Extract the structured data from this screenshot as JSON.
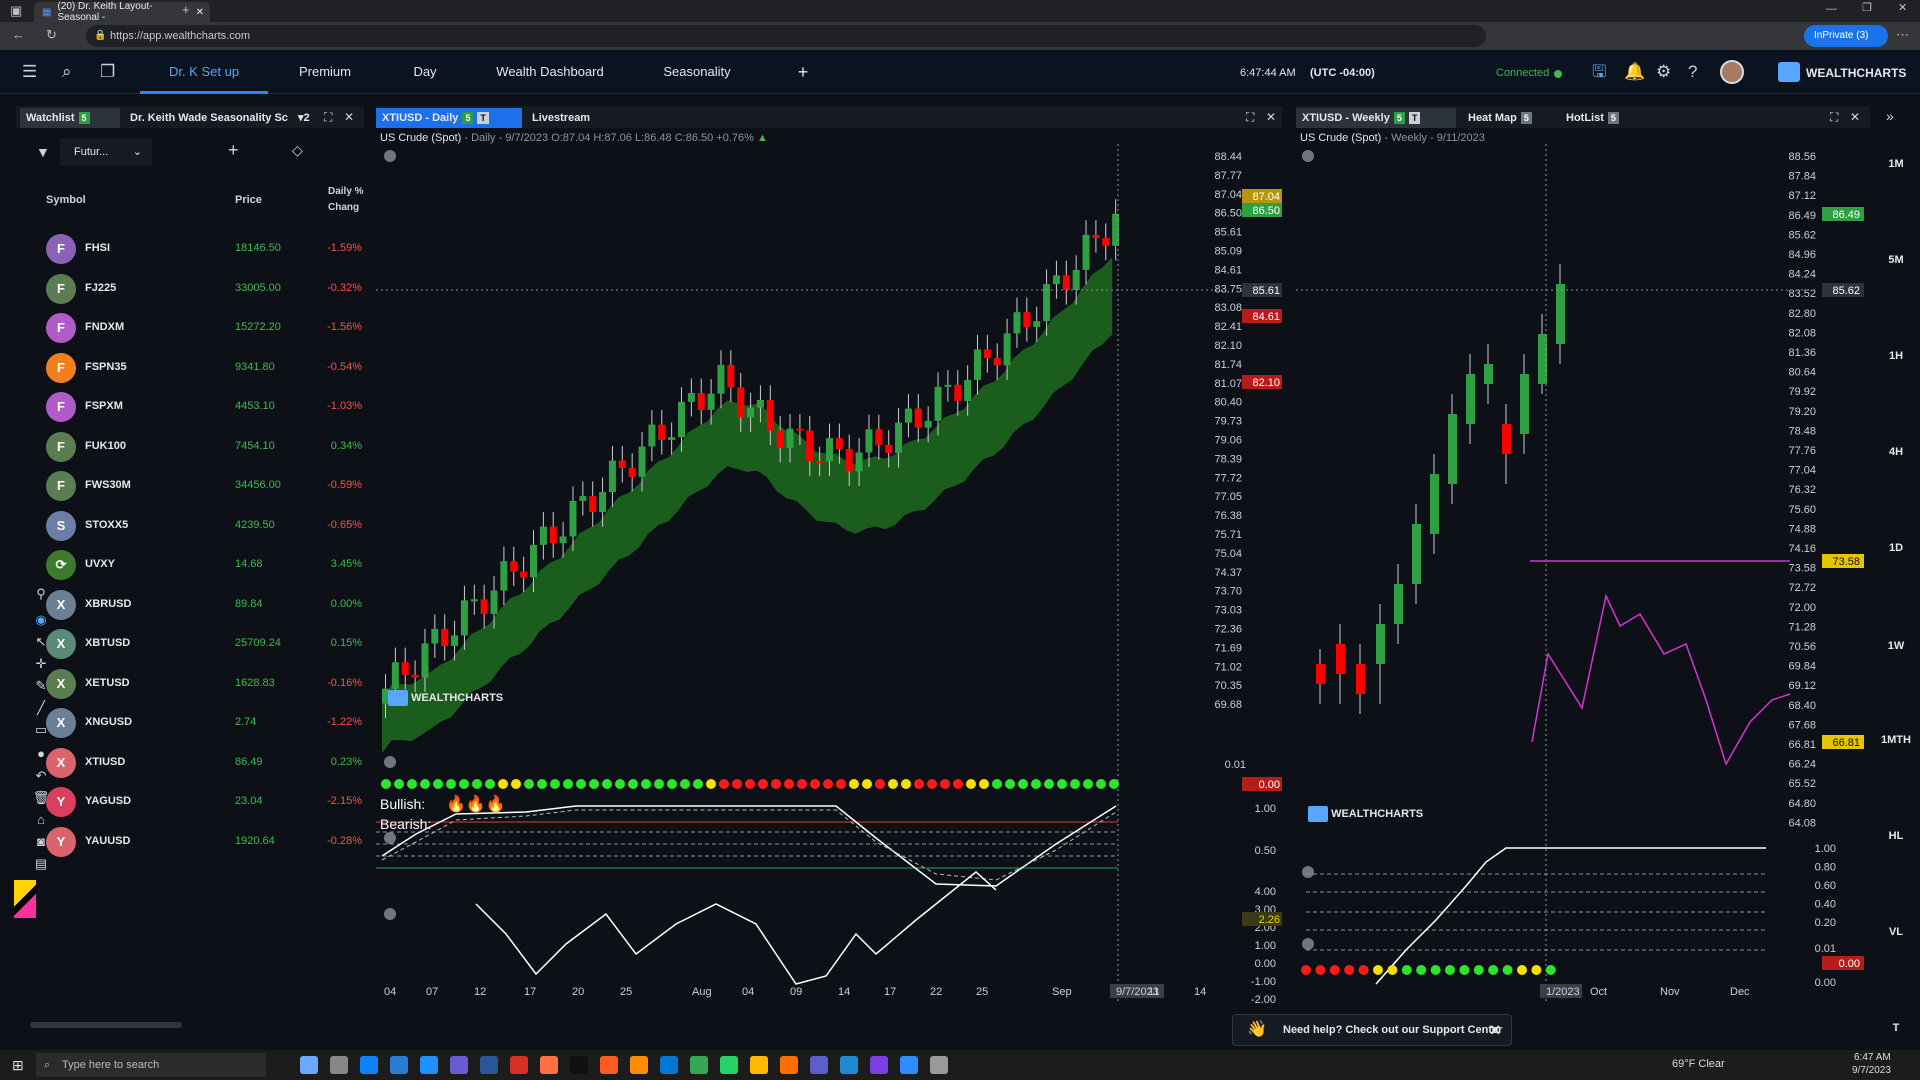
{
  "browser": {
    "tab_title": "(20) Dr. Keith Layout-Seasonal -",
    "url": "https://app.wealthcharts.com",
    "inprivate": "InPrivate (3)"
  },
  "header": {
    "tabs": [
      {
        "label": "Dr. K Set up",
        "active": true
      },
      {
        "label": "Premium"
      },
      {
        "label": "Day"
      },
      {
        "label": "Wealth Dashboard"
      },
      {
        "label": "Seasonality"
      }
    ],
    "add_tab": "+",
    "time": "6:47:44 AM",
    "timezone": "(UTC -04:00)",
    "status": "Connected",
    "brand": "WEALTHCHARTS",
    "accent": "#2f81f7"
  },
  "watchlist": {
    "tab_watchlist": "Watchlist",
    "tab_watchlist_badge": "5",
    "tab_layout": "Dr. Keith Wade Seasonality Sc",
    "layout_count": "2",
    "filter_value": "Futur...",
    "col_symbol": "Symbol",
    "col_price": "Price",
    "col_change_1": "Daily %",
    "col_change_2": "Chang",
    "rows": [
      {
        "letter": "F",
        "symbol": "FHSI",
        "price": "18146.50",
        "change": "-1.59%",
        "color": "#8a63b8",
        "neg": true
      },
      {
        "letter": "F",
        "symbol": "FJ225",
        "price": "33005.00",
        "change": "-0.32%",
        "color": "#5a7d52",
        "neg": true
      },
      {
        "letter": "F",
        "symbol": "FNDXM",
        "price": "15272.20",
        "change": "-1.56%",
        "color": "#b05bc7",
        "neg": true
      },
      {
        "letter": "F",
        "symbol": "FSPN35",
        "price": "9341.80",
        "change": "-0.54%",
        "color": "#f07f1f",
        "neg": true
      },
      {
        "letter": "F",
        "symbol": "FSPXM",
        "price": "4453.10",
        "change": "-1.03%",
        "color": "#b05bc7",
        "neg": true
      },
      {
        "letter": "F",
        "symbol": "FUK100",
        "price": "7454.10",
        "change": "0.34%",
        "color": "#5a7d52",
        "neg": false
      },
      {
        "letter": "F",
        "symbol": "FWS30M",
        "price": "34456.00",
        "change": "-0.59%",
        "color": "#5a7d52",
        "neg": true
      },
      {
        "letter": "S",
        "symbol": "STOXX5",
        "price": "4239.50",
        "change": "-0.65%",
        "color": "#6b7fa6",
        "neg": true
      },
      {
        "letter": "",
        "symbol": "UVXY",
        "price": "14.68",
        "change": "3.45%",
        "color": "#3d7a2e",
        "neg": false
      },
      {
        "letter": "X",
        "symbol": "XBRUSD",
        "price": "89.84",
        "change": "0.00%",
        "color": "#6b7f95",
        "neg": false
      },
      {
        "letter": "X",
        "symbol": "XBTUSD",
        "price": "25709.24",
        "change": "0.15%",
        "color": "#5a8a7a",
        "neg": false
      },
      {
        "letter": "X",
        "symbol": "XETUSD",
        "price": "1628.83",
        "change": "-0.16%",
        "color": "#5a7d52",
        "neg": true
      },
      {
        "letter": "X",
        "symbol": "XNGUSD",
        "price": "2.74",
        "change": "-1.22%",
        "color": "#6b7f95",
        "neg": true
      },
      {
        "letter": "X",
        "symbol": "XTIUSD",
        "price": "86.49",
        "change": "0.23%",
        "color": "#d9646e",
        "neg": false
      },
      {
        "letter": "Y",
        "symbol": "YAGUSD",
        "price": "23.04",
        "change": "-2.15%",
        "color": "#d94060",
        "neg": true
      },
      {
        "letter": "Y",
        "symbol": "YAUUSD",
        "price": "1920.64",
        "change": "-0.28%",
        "color": "#d9646e",
        "neg": true
      }
    ]
  },
  "daily_chart": {
    "tab_label": "XTIUSD - Daily",
    "tab_badge": "5",
    "tab_t": "T",
    "tab_livestream": "Livestream",
    "info_title": "US Crude (Spot)",
    "info_ohlc": "- Daily - 9/7/2023 O:87.04 H:87.06 L:86.48 C:86.50 +0.76%",
    "watermark": "WEALTHCHARTS",
    "y_ticks": [
      "88.44",
      "87.77",
      "87.04",
      "86.50",
      "85.61",
      "85.09",
      "84.61",
      "83.75",
      "83.08",
      "82.41",
      "82.10",
      "81.74",
      "81.07",
      "80.40",
      "79.73",
      "79.06",
      "78.39",
      "77.72",
      "77.05",
      "76.38",
      "75.71",
      "75.04",
      "74.37",
      "73.70",
      "73.03",
      "72.36",
      "71.69",
      "71.02",
      "70.35",
      "69.68"
    ],
    "price_tags": {
      "top": "87.04",
      "last": "86.50",
      "cross": "85.61",
      "red1": "84.61",
      "red2": "82.10"
    },
    "x_ticks": [
      "04",
      "07",
      "12",
      "17",
      "20",
      "25",
      "Aug",
      "04",
      "09",
      "14",
      "17",
      "22",
      "25",
      "Sep",
      "9/7/2023",
      "11",
      "14"
    ],
    "dots_axis": "0.01",
    "dots_tag": "0.00",
    "osc_ticks": [
      "1.00",
      "0.50"
    ],
    "bull_label": "Bullish:",
    "bear_label": "Bearish:",
    "mom_ticks": [
      "4.00",
      "3.00",
      "2.00",
      "1.00",
      "0.00",
      "-1.00",
      "-2.00"
    ],
    "mom_tag": "2.26",
    "up_color": "#2ea043",
    "down_color": "#f00"
  },
  "weekly_chart": {
    "tab_label": "XTIUSD - Weekly",
    "tab_badge": "5",
    "tab_t": "T",
    "tab_heatmap": "Heat Map",
    "tab_heatmap_badge": "5",
    "tab_hotlist": "HotList",
    "tab_hotlist_badge": "5",
    "info_title": "US Crude (Spot)",
    "info_sub": "- Weekly - 9/11/2023",
    "watermark": "WEALTHCHARTS",
    "y_ticks": [
      "88.56",
      "87.84",
      "87.12",
      "86.49",
      "85.62",
      "84.96",
      "84.24",
      "83.52",
      "82.80",
      "82.08",
      "81.36",
      "80.64",
      "79.92",
      "79.20",
      "78.48",
      "77.76",
      "77.04",
      "76.32",
      "75.60",
      "74.88",
      "74.16",
      "73.58",
      "72.72",
      "72.00",
      "71.28",
      "70.56",
      "69.84",
      "69.12",
      "68.40",
      "67.68",
      "66.81",
      "66.24",
      "65.52",
      "64.80",
      "64.08"
    ],
    "price_tags": {
      "last": "86.49",
      "cross": "85.62",
      "yellow1": "73.58",
      "yellow2": "66.81"
    },
    "osc_ticks": [
      "1.00",
      "0.80",
      "0.60",
      "0.40",
      "0.20"
    ],
    "dots_ticks": [
      "0.01",
      "0.00",
      "0.00"
    ],
    "x_ticks": [
      "1/2023",
      "Oct",
      "Nov",
      "Dec"
    ]
  },
  "timeframes": [
    "1M",
    "5M",
    "1H",
    "4H",
    "1D",
    "1W",
    "1MTH",
    "HL",
    "VL",
    "T"
  ],
  "support": {
    "text": "Need help? Check out our Support Center"
  },
  "taskbar": {
    "search_placeholder": "Type here to search",
    "weather": "69°F Clear",
    "time": "6:47 AM",
    "date": "9/7/2023"
  }
}
